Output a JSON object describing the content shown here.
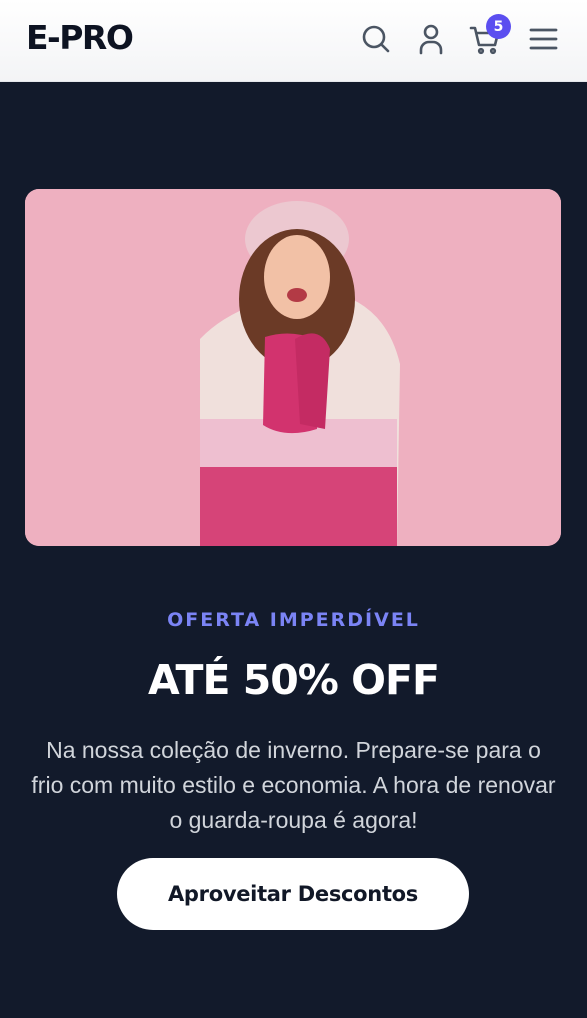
{
  "header": {
    "logo": "E-PRO",
    "cart_count": "5",
    "icons": [
      "search-icon",
      "user-icon",
      "cart-icon",
      "menu-icon"
    ]
  },
  "hero": {
    "kicker": "OFERTA IMPERDÍVEL",
    "headline": "ATÉ 50% OFF",
    "description": "Na nossa coleção de inverno. Prepare-se para o frio com muito estilo e economia. A hora de renovar o guarda-roupa é agora!",
    "cta_label": "Aproveitar Descontos"
  },
  "colors": {
    "page_bg": "#121a2b",
    "accent": "#5b4ef0",
    "kicker": "#7b84f5",
    "image_bg": "#eeb0c0"
  }
}
